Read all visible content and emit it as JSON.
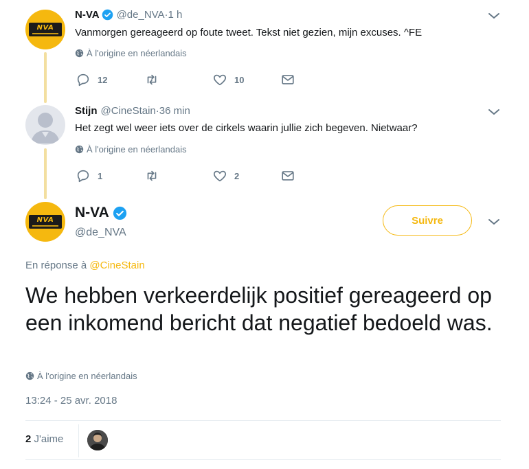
{
  "tweets": [
    {
      "name": "N-VA",
      "handle": "@de_NVA",
      "time": "·1 h",
      "text": "Vanmorgen gereageerd op foute tweet. Tekst niet gezien, mijn excuses. ^FE",
      "translate": "À l'origine en néerlandais",
      "replies": "12",
      "retweets": "",
      "likes": "10"
    },
    {
      "name": "Stijn",
      "handle": "@CineStain",
      "time": "·36 min",
      "text": "Het zegt wel weer iets over de cirkels waarin jullie zich begeven. Nietwaar?",
      "translate": "À l'origine en néerlandais",
      "replies": "1",
      "retweets": "",
      "likes": "2"
    }
  ],
  "main": {
    "name": "N-VA",
    "handle": "@de_NVA",
    "follow_label": "Suivre",
    "reply_prefix": "En réponse à",
    "reply_mention": "@CineStain",
    "text": "We hebben verkeerdelijk positief gereageerd op een inkomend bericht dat negatief bedoeld was.",
    "translate": "À l'origine en néerlandais",
    "timestamp": "13:24 - 25 avr. 2018",
    "likes_count": "2",
    "likes_label": "J'aime"
  },
  "avatar_logo_text": "NVA",
  "colors": {
    "accent": "#f5b80f",
    "verified": "#1da1f2",
    "muted": "#657786"
  }
}
